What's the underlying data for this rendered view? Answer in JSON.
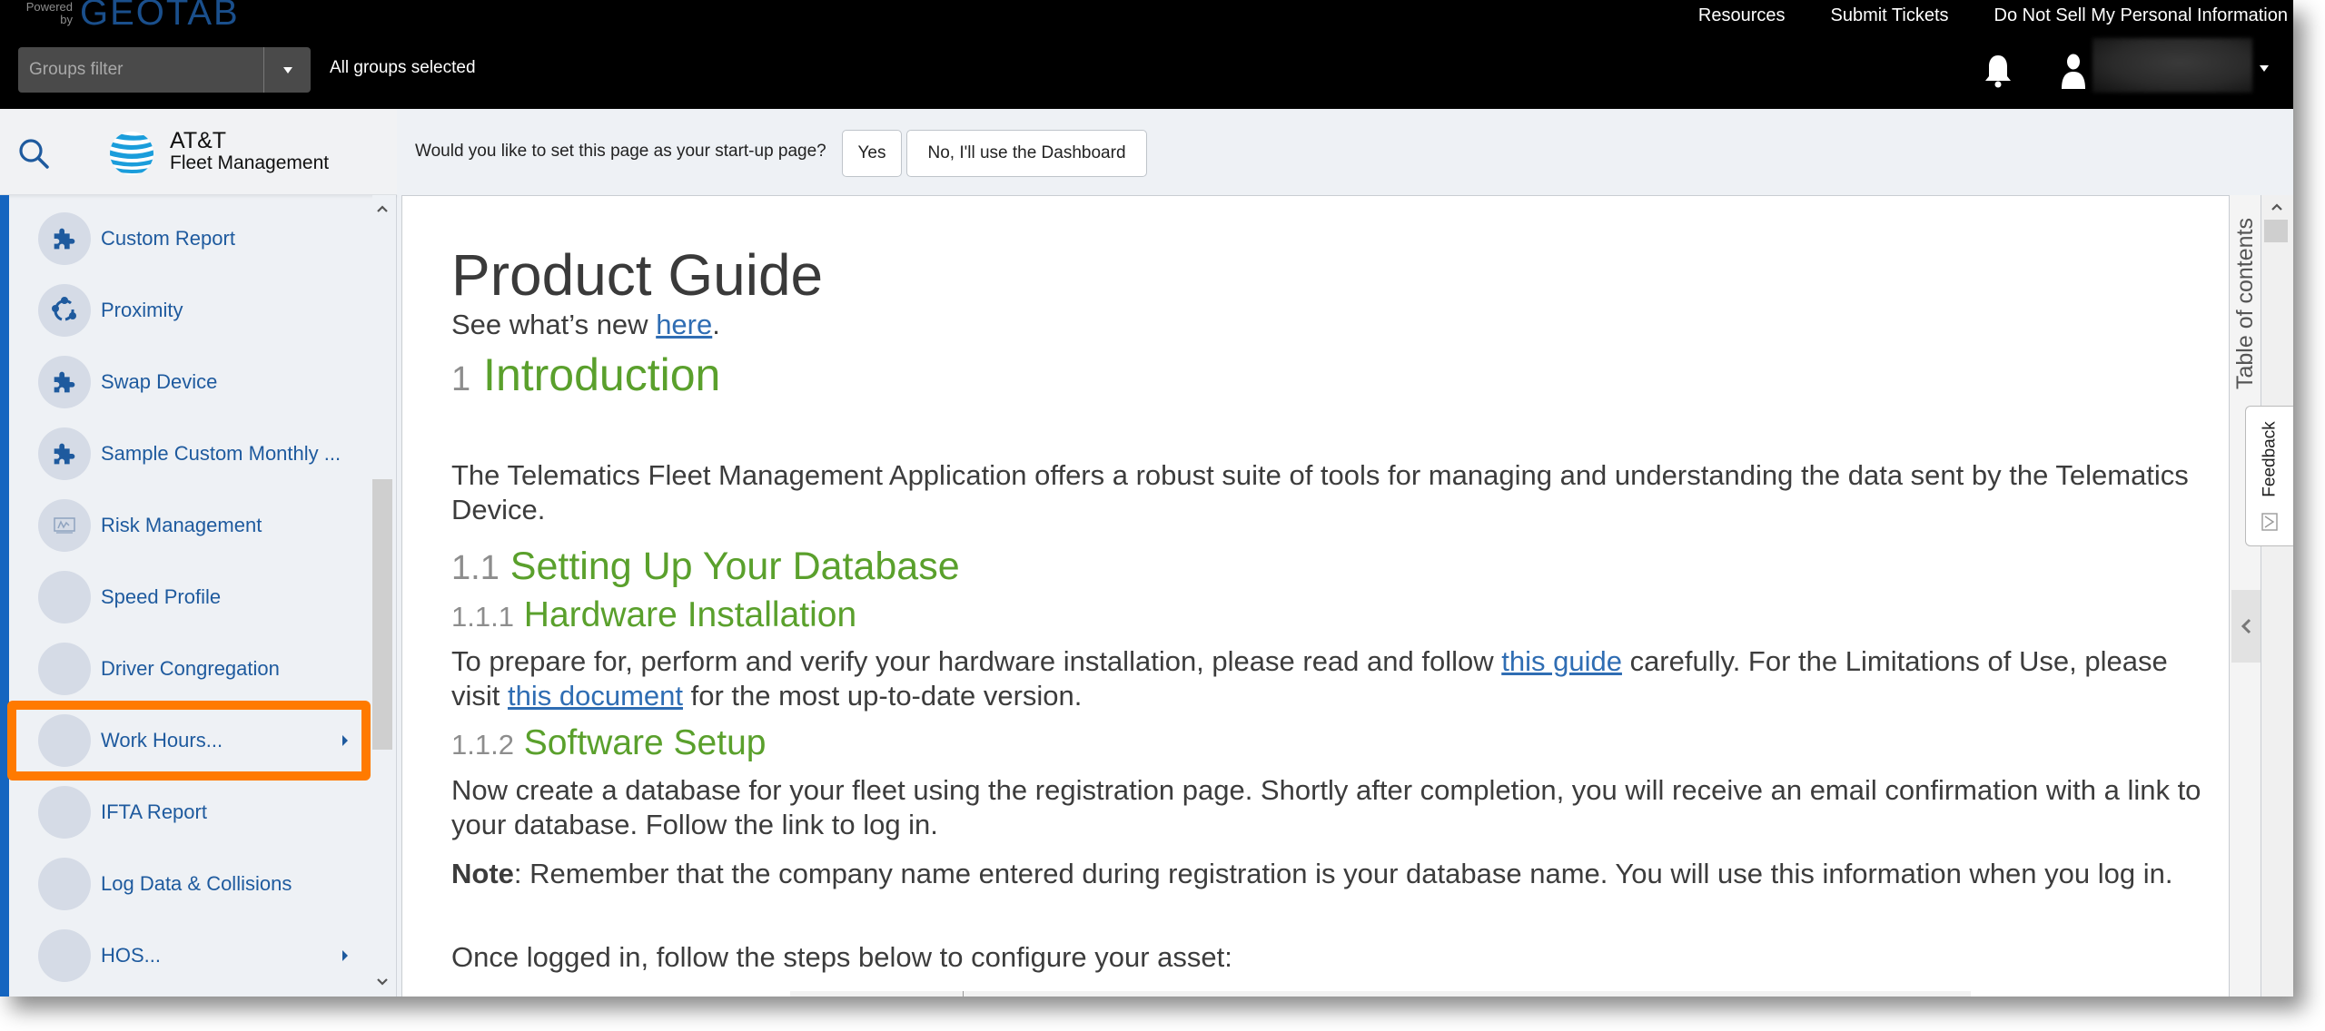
{
  "header": {
    "powered_by": [
      "Powered",
      "by"
    ],
    "brand": "GEOTAB",
    "links": [
      "Resources",
      "Submit Tickets",
      "Do Not Sell My Personal Information"
    ],
    "groups_filter": {
      "placeholder": "Groups filter",
      "status": "All groups selected"
    },
    "icons": {
      "notifications": "bell-icon",
      "user": "user-icon",
      "user_menu": "caret-down-icon"
    }
  },
  "sidebar": {
    "logo": {
      "line1": "AT&T",
      "line2": "Fleet Management"
    },
    "search_icon": "search-icon",
    "items": [
      {
        "label": "Custom Report",
        "icon": "puzzle-icon",
        "submenu": false
      },
      {
        "label": "Proximity",
        "icon": "proximity-icon",
        "submenu": false
      },
      {
        "label": "Swap Device",
        "icon": "puzzle-icon",
        "submenu": false
      },
      {
        "label": "Sample Custom Monthly ...",
        "icon": "puzzle-icon",
        "submenu": false
      },
      {
        "label": "Risk Management",
        "icon": "chart-icon",
        "submenu": false
      },
      {
        "label": "Speed Profile",
        "icon": "",
        "submenu": false
      },
      {
        "label": "Driver Congregation",
        "icon": "",
        "submenu": false
      },
      {
        "label": "Work Hours...",
        "icon": "",
        "submenu": true,
        "highlighted": true
      },
      {
        "label": "IFTA Report",
        "icon": "",
        "submenu": false
      },
      {
        "label": "Log Data & Collisions",
        "icon": "",
        "submenu": false
      },
      {
        "label": "HOS...",
        "icon": "",
        "submenu": true
      }
    ],
    "highlight_color": "#ff7a00"
  },
  "startup_prompt": {
    "question": "Would you like to set this page as your start-up page?",
    "yes_label": "Yes",
    "no_label": "No, I'll use the Dashboard"
  },
  "document": {
    "title": "Product Guide",
    "whats_new": {
      "prefix": "See what’s new ",
      "link": "here",
      "suffix": "."
    },
    "sections": {
      "intro": {
        "num": "1",
        "title": "Introduction"
      },
      "intro_text": "The Telematics Fleet Management Application offers a robust suite of tools for managing and understanding the data sent by the Telematics Device.",
      "db": {
        "num": "1.1",
        "title": "Setting Up Your Database"
      },
      "hw": {
        "num": "1.1.1",
        "title": "Hardware Installation"
      },
      "hw_text": {
        "part1": "To prepare for, perform and verify your hardware installation, please read and follow ",
        "link1": "this guide",
        "part2": " carefully. For the Limitations of Use, please visit ",
        "link2": "this document",
        "part3": " for the most up-to-date version."
      },
      "sw": {
        "num": "1.1.2",
        "title": "Software Setup"
      },
      "sw_text": "Now create a database for your fleet using the registration page. Shortly after completion, you will receive an email confirmation with a link to your database. Follow the link to log in.",
      "note": {
        "label": "Note",
        "text": ": Remember that the company name entered during registration is your database name. You will use this information when you log in."
      },
      "steps_intro": "Once logged in, follow the steps below to configure your asset:"
    },
    "colors": {
      "heading": "#5aa02c",
      "link": "#2f6db3",
      "number": "#8d8d8d"
    }
  },
  "right_panel": {
    "toc_label": "Table of contents",
    "feedback_label": "Feedback"
  }
}
